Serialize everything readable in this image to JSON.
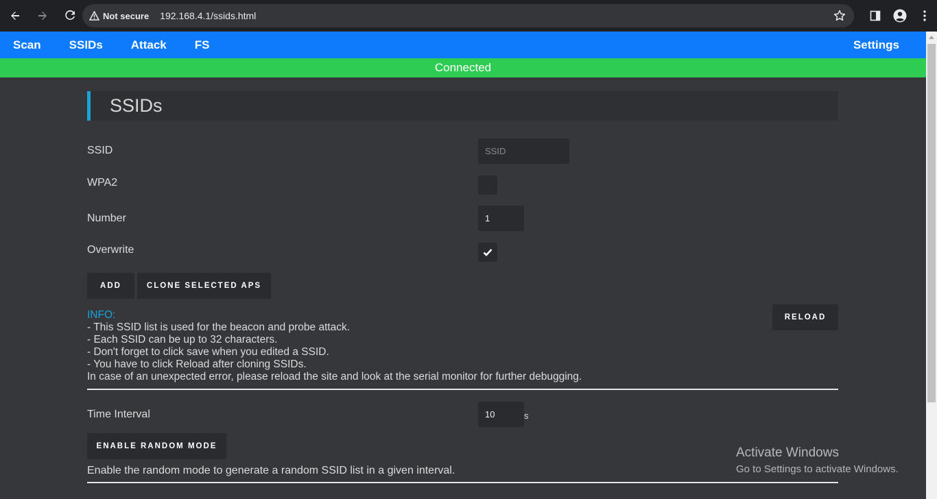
{
  "browser": {
    "security_label": "Not secure",
    "url": "192.168.4.1/ssids.html"
  },
  "nav": {
    "items": [
      "Scan",
      "SSIDs",
      "Attack",
      "FS"
    ],
    "settings": "Settings"
  },
  "status": "Connected",
  "page": {
    "title": "SSIDs",
    "form": {
      "ssid_label": "SSID",
      "ssid_placeholder": "SSID",
      "wpa2_label": "WPA2",
      "wpa2_checked": false,
      "number_label": "Number",
      "number_value": "1",
      "overwrite_label": "Overwrite",
      "overwrite_checked": true
    },
    "buttons": {
      "add": "ADD",
      "clone": "CLONE SELECTED APS",
      "reload": "RELOAD",
      "random": "ENABLE RANDOM MODE"
    },
    "info": {
      "title": "INFO:",
      "lines": [
        "- This SSID list is used for the beacon and probe attack.",
        "- Each SSID can be up to 32 characters.",
        "- Don't forget to click save when you edited a SSID.",
        "- You have to click Reload after cloning SSIDs.",
        "In case of an unexpected error, please reload the site and look at the serial monitor for further debugging."
      ]
    },
    "interval": {
      "label": "Time Interval",
      "value": "10",
      "unit": "s"
    },
    "random_description": "Enable the random mode to generate a random SSID list in a given interval."
  },
  "watermark": {
    "line1": "Activate Windows",
    "line2": "Go to Settings to activate Windows."
  }
}
